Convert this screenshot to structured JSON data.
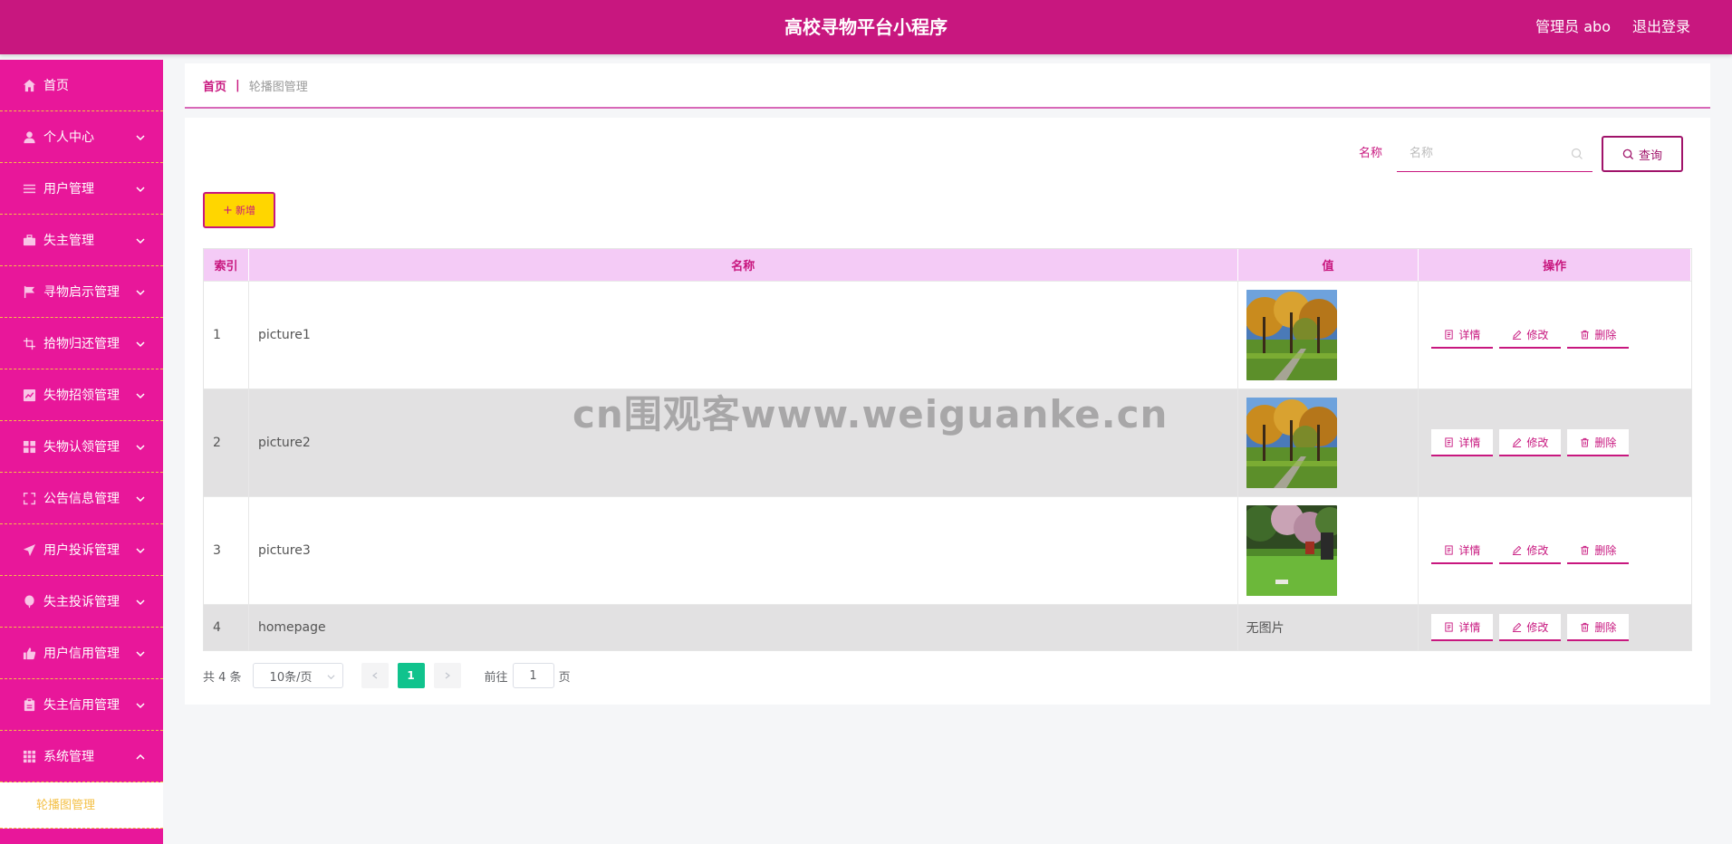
{
  "header": {
    "title": "高校寻物平台小程序",
    "user": "管理员 abo",
    "logout": "退出登录"
  },
  "sidebar": {
    "items": [
      {
        "label": "首页",
        "icon": "home-icon"
      },
      {
        "label": "个人中心",
        "icon": "user-icon"
      },
      {
        "label": "用户管理",
        "icon": "list-icon"
      },
      {
        "label": "失主管理",
        "icon": "briefcase-icon"
      },
      {
        "label": "寻物启示管理",
        "icon": "flag-icon"
      },
      {
        "label": "拾物归还管理",
        "icon": "crop-icon"
      },
      {
        "label": "失物招领管理",
        "icon": "chart-icon"
      },
      {
        "label": "失物认领管理",
        "icon": "grid-icon"
      },
      {
        "label": "公告信息管理",
        "icon": "fullscreen-icon"
      },
      {
        "label": "用户投诉管理",
        "icon": "send-icon"
      },
      {
        "label": "失主投诉管理",
        "icon": "balloon-icon"
      },
      {
        "label": "用户信用管理",
        "icon": "thumb-icon"
      },
      {
        "label": "失主信用管理",
        "icon": "clipboard-icon"
      },
      {
        "label": "系统管理",
        "icon": "apps-icon"
      }
    ],
    "submenu": [
      "轮播图管理"
    ]
  },
  "breadcrumb": {
    "home": "首页",
    "separator": "|",
    "current": "轮播图管理"
  },
  "search": {
    "label": "名称",
    "placeholder": "名称",
    "button": "查询"
  },
  "add_button": "新增",
  "table": {
    "headers": [
      "索引",
      "名称",
      "值",
      "操作"
    ],
    "rows": [
      {
        "index": "1",
        "name": "picture1",
        "value_type": "image",
        "image": "autumn-trees"
      },
      {
        "index": "2",
        "name": "picture2",
        "value_type": "image",
        "image": "autumn-trees"
      },
      {
        "index": "3",
        "name": "picture3",
        "value_type": "image",
        "image": "spring-garden"
      },
      {
        "index": "4",
        "name": "homepage",
        "value_type": "text",
        "value_text": "无图片"
      }
    ],
    "actions": {
      "detail": "详情",
      "edit": "修改",
      "delete": "删除"
    }
  },
  "pagination": {
    "total": "共 4 条",
    "page_size": "10条/页",
    "current_page": "1",
    "goto_label": "前往",
    "goto_value": "1",
    "goto_suffix": "页"
  },
  "watermark": "cn围观客www.weiguanke.cn",
  "colors": {
    "header": "#c8177f",
    "sidebar": "#e8179a",
    "accent": "#c8177f",
    "add_button": "#ffd600",
    "table_header": "#f4cbf6",
    "page_active": "#10c38d",
    "divider": "#f4c046"
  }
}
